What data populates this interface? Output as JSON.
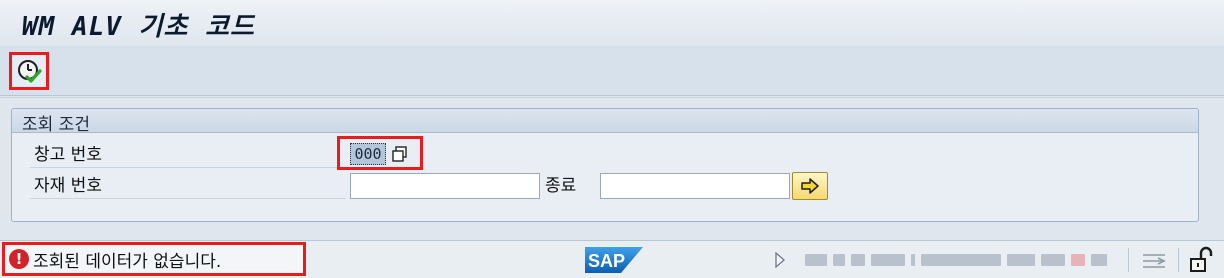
{
  "window": {
    "title": "WM ALV 기초 코드"
  },
  "toolbar": {
    "execute_icon": "execute-clock-check-icon"
  },
  "selection": {
    "group_title": "조회 조건",
    "ref_label": "창고 번호",
    "ref_value": "000",
    "material_label": "자재 번호",
    "material_from": "",
    "to_label": "종료",
    "material_to": "",
    "multiple_selection_icon": "multiple-selection-arrow-icon"
  },
  "status": {
    "type": "error",
    "icon_glyph": "!",
    "message": "조회된 데이터가 없습니다."
  },
  "colors": {
    "highlight": "#e81c1c",
    "error": "#d2232a",
    "sap_blue": "#1a76c9"
  },
  "system": {
    "logo_text": "SAP"
  }
}
